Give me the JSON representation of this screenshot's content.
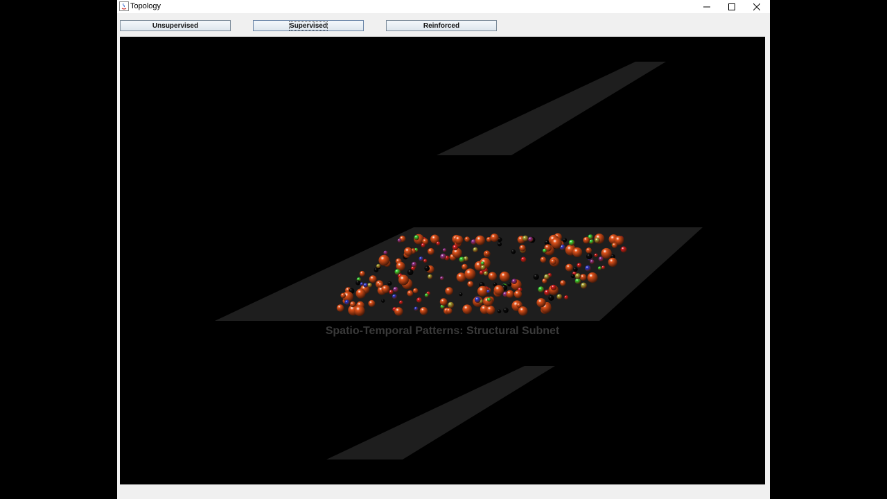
{
  "window": {
    "title": "Topology",
    "controls": [
      "minimize",
      "maximize",
      "close"
    ]
  },
  "toolbar": {
    "unsupervised_label": "Unsupervised",
    "supervised_label": "Supervised",
    "reinforced_label": "Reinforced",
    "focused_button": "Supervised"
  },
  "scene": {
    "caption": "Spatio-Temporal Patterns: Structural Subnet",
    "background": "#000000",
    "plane_color": "#1e1e1e",
    "neuron_colors": {
      "orange": "#e0521a",
      "red": "#d4161c",
      "green": "#2fd22f",
      "blue": "#2233cc",
      "purple": "#8a2a8a",
      "olive": "#a0a030",
      "black": "#0c0c0c"
    }
  }
}
